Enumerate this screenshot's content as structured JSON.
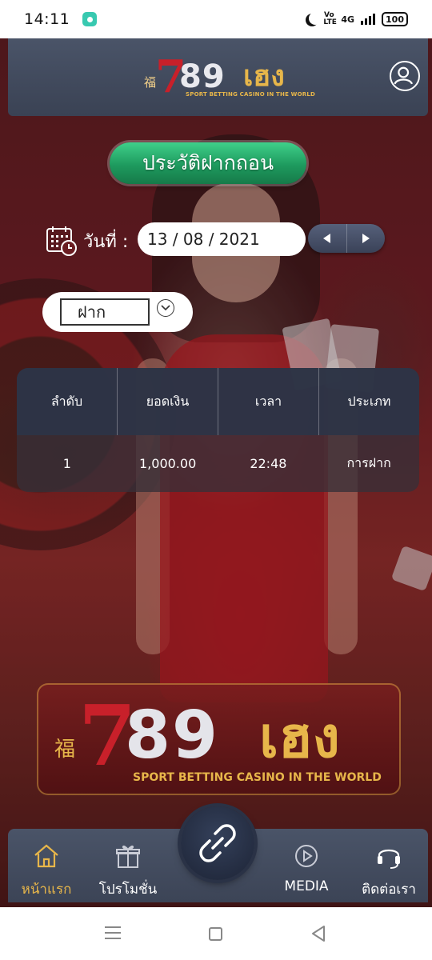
{
  "status_bar": {
    "time": "14:11",
    "network": "4G",
    "volte": "Vo LTE",
    "battery": "100"
  },
  "header": {
    "logo": {
      "fu": "福",
      "seven": "7",
      "eighty_nine": "89",
      "heng": "เฮง",
      "tagline": "SPORT BETTING CASINO IN THE WORLD"
    },
    "profile_icon": "user-circle-icon"
  },
  "page": {
    "title": "ประวัติฝากถอน",
    "date_label": "วันที่ :",
    "date_value": "13 / 08 / 2021",
    "prev_icon": "triangle-left-icon",
    "next_icon": "triangle-right-icon",
    "filter_value": "ฝาก",
    "filter_icon": "chevron-down-icon"
  },
  "table": {
    "headers": [
      "ลำดับ",
      "ยอดเงิน",
      "เวลา",
      "ประเภท"
    ],
    "rows": [
      [
        "1",
        "1,000.00",
        "22:48",
        "การฝาก"
      ]
    ]
  },
  "bottom_nav": {
    "items": [
      {
        "label": "หน้าแรก",
        "icon": "home-icon",
        "active": true
      },
      {
        "label": "โปรโมชั่น",
        "icon": "gift-icon",
        "active": false
      },
      {
        "label": "MEDIA",
        "icon": "play-circle-icon",
        "active": false
      },
      {
        "label": "ติดต่อเรา",
        "icon": "headset-icon",
        "active": false
      }
    ],
    "center_icon": "link-icon"
  },
  "colors": {
    "header_bg": "#424b5e",
    "title_green": "#1e9a5e",
    "gold": "#e7b64a",
    "brand_red": "#c8202a"
  }
}
